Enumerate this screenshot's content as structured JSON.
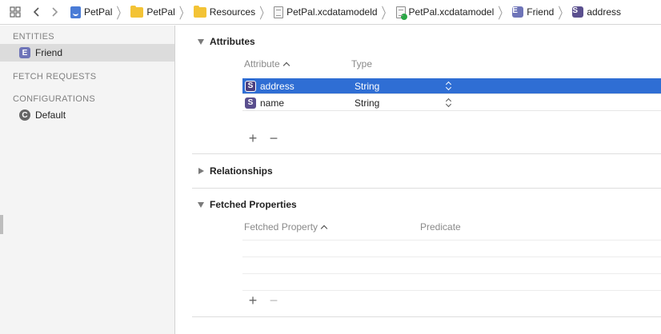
{
  "jumpbar": {
    "crumbs": [
      {
        "label": "PetPal",
        "icon": "project-icon"
      },
      {
        "label": "PetPal",
        "icon": "folder-icon"
      },
      {
        "label": "Resources",
        "icon": "folder-icon"
      },
      {
        "label": "PetPal.xcdatamodeld",
        "icon": "datamodel-bundle-icon"
      },
      {
        "label": "PetPal.xcdatamodel",
        "icon": "datamodel-file-icon"
      },
      {
        "label": "Friend",
        "icon": "entity-icon",
        "badge": "E"
      },
      {
        "label": "address",
        "icon": "attribute-icon",
        "badge": "S"
      }
    ]
  },
  "sidebar": {
    "entities_header": "ENTITIES",
    "entities": [
      {
        "label": "Friend",
        "badge": "E",
        "selected": true
      }
    ],
    "fetch_requests_header": "FETCH REQUESTS",
    "configurations_header": "CONFIGURATIONS",
    "configurations": [
      {
        "label": "Default",
        "badge": "C"
      }
    ]
  },
  "attributes": {
    "title": "Attributes",
    "col_attribute": "Attribute",
    "col_type": "Type",
    "rows": [
      {
        "name": "address",
        "badge": "S",
        "type": "String",
        "selected": true
      },
      {
        "name": "name",
        "badge": "S",
        "type": "String",
        "selected": false
      }
    ],
    "add_symbol": "+",
    "remove_symbol": "−"
  },
  "relationships": {
    "title": "Relationships"
  },
  "fetched_properties": {
    "title": "Fetched Properties",
    "col_property": "Fetched Property",
    "col_predicate": "Predicate",
    "add_symbol": "+",
    "remove_symbol": "−"
  },
  "colors": {
    "selection": "#2f6ed4",
    "entity_badge": "#6e74b8",
    "string_badge": "#5a4f8e"
  }
}
